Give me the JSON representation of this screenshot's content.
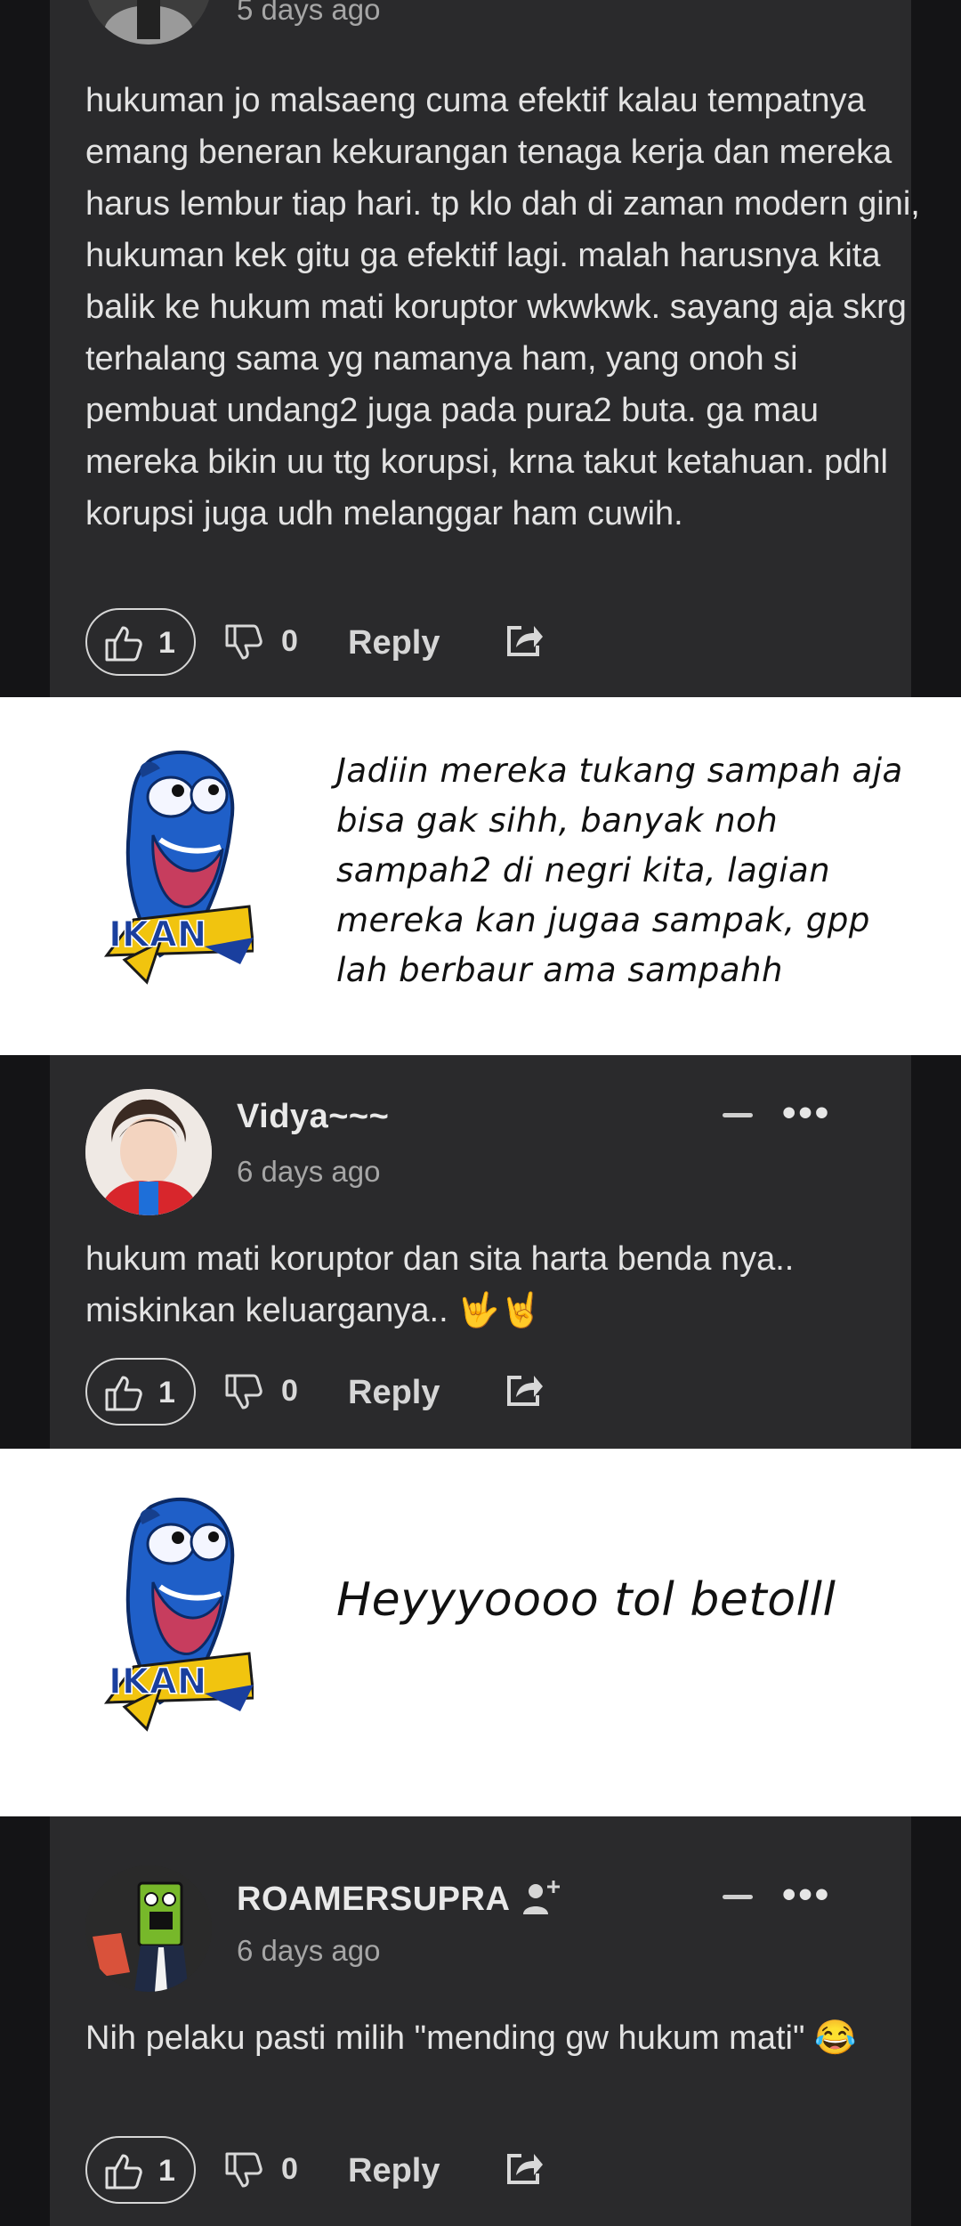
{
  "comments": [
    {
      "time": "5 days ago",
      "text": "hukuman jo malsaeng cuma efektif kalau tempatnya emang beneran kekurangan tenaga kerja dan mereka harus lembur tiap hari. tp klo dah di zaman modern gini, hukuman kek gitu ga efektif lagi. malah harusnya kita balik ke hukum mati koruptor wkwkwk. sayang aja skrg terhalang sama yg namanya ham, yang onoh si pembuat undang2 juga pada pura2 buta. ga mau mereka bikin uu ttg korupsi, krna takut ketahuan. pdhl korupsi juga udh melanggar ham cuwih.",
      "likes": "1",
      "dislikes": "0",
      "reply_label": "Reply"
    },
    {
      "username": "Vidya~~~",
      "time": "6 days ago",
      "text": "hukum mati koruptor dan sita harta benda nya.. miskinkan keluarganya.. 🤟🤘",
      "likes": "1",
      "dislikes": "0",
      "reply_label": "Reply"
    },
    {
      "username": "ROAMERSUPRA",
      "time": "6 days ago",
      "text": "Nih pelaku pasti milih \"mending gw hukum mati\" 😂",
      "likes": "1",
      "dislikes": "0",
      "reply_label": "Reply"
    }
  ],
  "memes": [
    {
      "badge": "IKAN",
      "text": "Jadiin mereka tukang sampah aja bisa gak sihh, banyak noh sampah2 di negri kita, lagian mereka kan jugaa sampak, gpp lah berbaur ama sampahh"
    },
    {
      "badge": "IKAN",
      "text": "Heyyyoooo tol betolll"
    }
  ],
  "icons": {
    "like": "thumbs-up-icon",
    "dislike": "thumbs-down-icon",
    "share": "share-icon",
    "add_user": "add-user-icon",
    "more": "more-icon",
    "collapse": "collapse-icon"
  },
  "colors": {
    "card": "#2a2a2c",
    "background": "#141416",
    "meme_background": "#ffffff",
    "fish_blue": "#1f5fc8",
    "badge_yellow": "#f1c40f",
    "badge_text": "#1a3f9e"
  }
}
